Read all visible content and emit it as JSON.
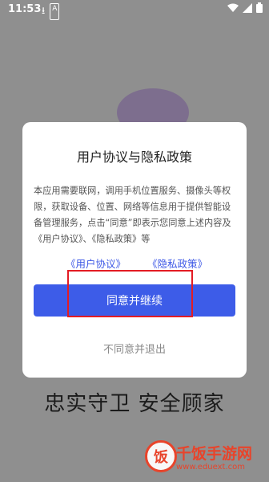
{
  "status_bar": {
    "time": "11:53",
    "icons_left": [
      "download-icon",
      "a-badge-icon"
    ],
    "icons_right": [
      "wifi-icon",
      "signal-icon",
      "battery-icon"
    ]
  },
  "background": {
    "slogan": "忠实守卫 安全顾家"
  },
  "dialog": {
    "title": "用户协议与隐私政策",
    "body": "本应用需要联网，调用手机位置服务、摄像头等权限，获取设备、位置、网络等信息用于提供智能设备管理服务，点击“同意”即表示您同意上述内容及《用户协议》、《隐私政策》等",
    "link_user_agreement": "《用户协议》",
    "link_privacy_policy": "《隐私政策》",
    "agree_button": "同意并继续",
    "decline_button": "不同意并退出"
  },
  "watermark": {
    "brand": "千饭手游网",
    "url": "www.eduext.com",
    "logo_char": "饭"
  },
  "colors": {
    "primary": "#3d5ce8",
    "highlight_box": "#e31c24",
    "watermark": "#e8442b"
  }
}
